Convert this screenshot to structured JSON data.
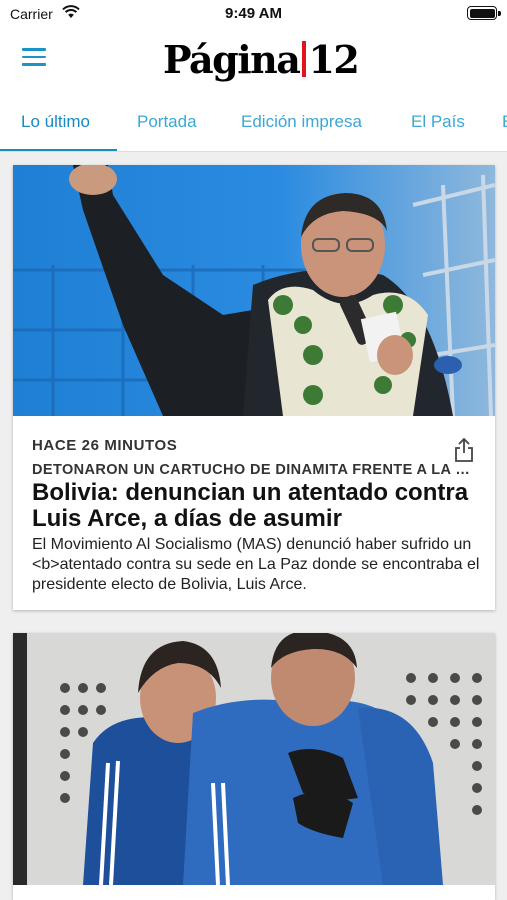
{
  "status_bar": {
    "carrier": "Carrier",
    "time": "9:49 AM"
  },
  "header": {
    "logo_left": "Página",
    "logo_right": "12"
  },
  "tabs": [
    {
      "label": "Lo último",
      "active": true
    },
    {
      "label": "Portada"
    },
    {
      "label": "Edición impresa"
    },
    {
      "label": "El País"
    },
    {
      "label": "E"
    }
  ],
  "articles": [
    {
      "time": "HACE 26 MINUTOS",
      "kicker": "DETONARON UN CARTUCHO DE DINAMITA FRENTE A LA SEDE DEL MAS",
      "headline": "Bolivia: denuncian un atentado contra Luis Arce, a días de asumir",
      "summary": "El Movimiento Al Socialismo (MAS) denunció haber sufrido un <b>atentado contra su sede en La Paz donde se encontraba el presidente electo de Bolivia, Luis Arce."
    }
  ],
  "colors": {
    "accent": "#1a89c2",
    "logo_bar": "#e3131b",
    "background": "#efefef"
  }
}
